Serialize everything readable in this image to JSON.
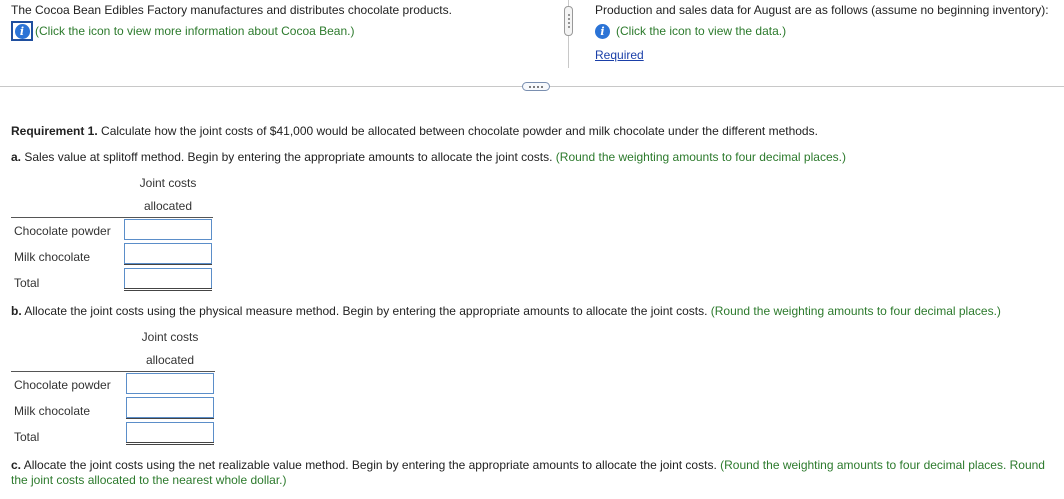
{
  "left_panel": {
    "intro": "The Cocoa Bean Edibles Factory manufactures and distributes chocolate products.",
    "info_link": "(Click the icon to view more information about Cocoa Bean.)"
  },
  "right_panel": {
    "intro": "Production and sales data for August are as follows (assume no beginning inventory):",
    "info_link": "(Click the icon to view the data.)",
    "required_link": "Required"
  },
  "requirement": {
    "label": "Requirement 1.",
    "text": " Calculate how the joint costs of $41,000 would be allocated between chocolate powder and milk chocolate under the different methods."
  },
  "part_a": {
    "prefix": "a.",
    "text": " Sales value at splitoff method. Begin by entering the appropriate amounts to allocate the joint costs.",
    "hint": " (Round the weighting amounts to four decimal places.)",
    "header_line1": "Joint costs",
    "header_line2": "allocated",
    "rows": [
      "Chocolate powder",
      "Milk chocolate",
      "Total"
    ]
  },
  "part_b": {
    "prefix": "b.",
    "text": " Allocate the joint costs using the physical measure method. Begin by entering the appropriate amounts to allocate the joint costs.",
    "hint": " (Round the weighting amounts to four decimal places.)",
    "header_line1": "Joint costs",
    "header_line2": "allocated",
    "rows": [
      "Chocolate powder",
      "Milk chocolate",
      "Total"
    ]
  },
  "part_c": {
    "prefix": "c.",
    "text": " Allocate the joint costs using the net realizable value method. Begin by entering the appropriate amounts to allocate the joint costs.",
    "hint": " (Round the weighting amounts to four decimal places. Round the joint costs allocated to the nearest whole dollar.)"
  },
  "icons": {
    "info": "info-icon",
    "splitter": "vertical-splitter-handle",
    "divider": "horizontal-divider-handle"
  },
  "colors": {
    "hint_green": "#2c7a2c",
    "link_blue": "#1a3fa8",
    "info_blue": "#2b73d6",
    "input_border": "#5b8ec9"
  }
}
